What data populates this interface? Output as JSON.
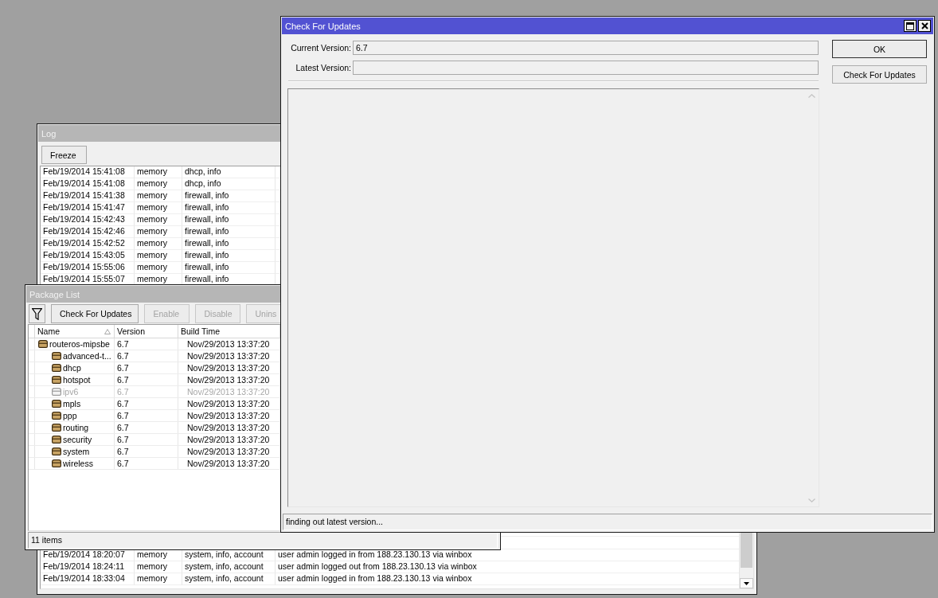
{
  "log_window": {
    "title": "Log",
    "active": false,
    "toolbar_buttons": [
      {
        "label": "Freeze",
        "disabled": false
      }
    ],
    "entries_top": [
      {
        "time": "Feb/19/2014 15:41:08",
        "buffer": "memory",
        "topics": "dhcp, info"
      },
      {
        "time": "Feb/19/2014 15:41:08",
        "buffer": "memory",
        "topics": "dhcp, info"
      },
      {
        "time": "Feb/19/2014 15:41:38",
        "buffer": "memory",
        "topics": "firewall, info"
      },
      {
        "time": "Feb/19/2014 15:41:47",
        "buffer": "memory",
        "topics": "firewall, info"
      },
      {
        "time": "Feb/19/2014 15:42:43",
        "buffer": "memory",
        "topics": "firewall, info"
      },
      {
        "time": "Feb/19/2014 15:42:46",
        "buffer": "memory",
        "topics": "firewall, info"
      },
      {
        "time": "Feb/19/2014 15:42:52",
        "buffer": "memory",
        "topics": "firewall, info"
      },
      {
        "time": "Feb/19/2014 15:43:05",
        "buffer": "memory",
        "topics": "firewall, info"
      },
      {
        "time": "Feb/19/2014 15:55:06",
        "buffer": "memory",
        "topics": "firewall, info"
      },
      {
        "time": "Feb/19/2014 15:55:07",
        "buffer": "memory",
        "topics": "firewall, info"
      }
    ],
    "entries_bottom": [
      {
        "time": "Feb/19/2014 18:20:07",
        "buffer": "memory",
        "topics": "system, info, account",
        "message": "user admin logged in from 188.23.130.13 via winbox"
      },
      {
        "time": "Feb/19/2014 18:24:11",
        "buffer": "memory",
        "topics": "system, info, account",
        "message": "user admin logged out from 188.23.130.13 via winbox"
      },
      {
        "time": "Feb/19/2014 18:33:04",
        "buffer": "memory",
        "topics": "system, info, account",
        "message": "user admin logged in from 188.23.130.13 via winbox"
      }
    ]
  },
  "package_list_window": {
    "title": "Package List",
    "active": false,
    "toolbar_buttons": [
      {
        "label": "Check For Updates",
        "disabled": false
      },
      {
        "label": "Enable",
        "disabled": true
      },
      {
        "label": "Disable",
        "disabled": true
      },
      {
        "label": "Unins",
        "disabled": true
      }
    ],
    "columns": [
      {
        "label": "Name",
        "sorted": true
      },
      {
        "label": "Version",
        "sorted": false
      },
      {
        "label": "Build Time",
        "sorted": false
      }
    ],
    "packages": [
      {
        "name": "routeros-mipsbe",
        "version": "6.7",
        "build_time": "Nov/29/2013 13:37:20",
        "disabled": false,
        "children": [
          {
            "name": "advanced-t...",
            "version": "6.7",
            "build_time": "Nov/29/2013 13:37:20",
            "disabled": false
          },
          {
            "name": "dhcp",
            "version": "6.7",
            "build_time": "Nov/29/2013 13:37:20",
            "disabled": false
          },
          {
            "name": "hotspot",
            "version": "6.7",
            "build_time": "Nov/29/2013 13:37:20",
            "disabled": false
          },
          {
            "name": "ipv6",
            "version": "6.7",
            "build_time": "Nov/29/2013 13:37:20",
            "disabled": true
          },
          {
            "name": "mpls",
            "version": "6.7",
            "build_time": "Nov/29/2013 13:37:20",
            "disabled": false
          },
          {
            "name": "ppp",
            "version": "6.7",
            "build_time": "Nov/29/2013 13:37:20",
            "disabled": false
          },
          {
            "name": "routing",
            "version": "6.7",
            "build_time": "Nov/29/2013 13:37:20",
            "disabled": false
          },
          {
            "name": "security",
            "version": "6.7",
            "build_time": "Nov/29/2013 13:37:20",
            "disabled": false
          },
          {
            "name": "system",
            "version": "6.7",
            "build_time": "Nov/29/2013 13:37:20",
            "disabled": false
          },
          {
            "name": "wireless",
            "version": "6.7",
            "build_time": "Nov/29/2013 13:37:20",
            "disabled": false
          }
        ]
      }
    ],
    "status": "11 items"
  },
  "check_for_updates_window": {
    "title": "Check For Updates",
    "active": true,
    "fields": [
      {
        "label": "Current Version:",
        "value": "6.7"
      },
      {
        "label": "Latest Version:"
      }
    ],
    "buttons": [
      {
        "label": "OK",
        "default": true
      },
      {
        "label": "Check For Updates",
        "default": false
      }
    ],
    "status": "finding out latest version..."
  }
}
